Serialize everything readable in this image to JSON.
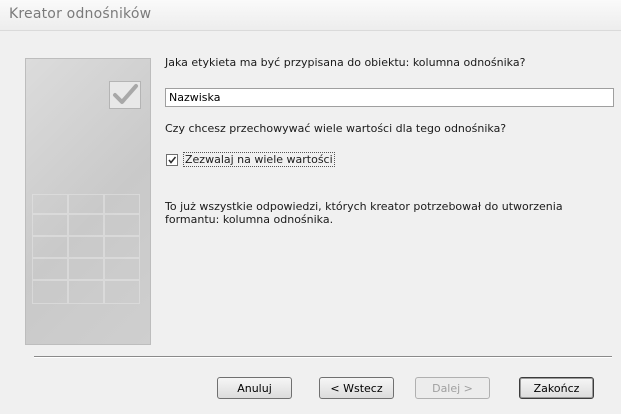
{
  "window": {
    "title": "Kreator odnośników"
  },
  "question_label": "Jaka etykieta ma być przypisana do obiektu: kolumna odnośnika?",
  "label_input": {
    "value": "Nazwiska"
  },
  "question_multi": "Czy chcesz przechowywać wiele wartości dla tego odnośnika?",
  "allow_multiple": {
    "label": "Zezwalaj na wiele wartości",
    "checked": true
  },
  "info_text": "To już wszystkie odpowiedzi, których kreator potrzebował do utworzenia formantu: kolumna odnośnika.",
  "buttons": {
    "cancel": "Anuluj",
    "back": "< Wstecz",
    "next": "Dalej >",
    "finish": "Zakończ"
  },
  "icons": {
    "wizard_art": "checkmark-card-icon",
    "checkbox": "checkmark-icon"
  }
}
